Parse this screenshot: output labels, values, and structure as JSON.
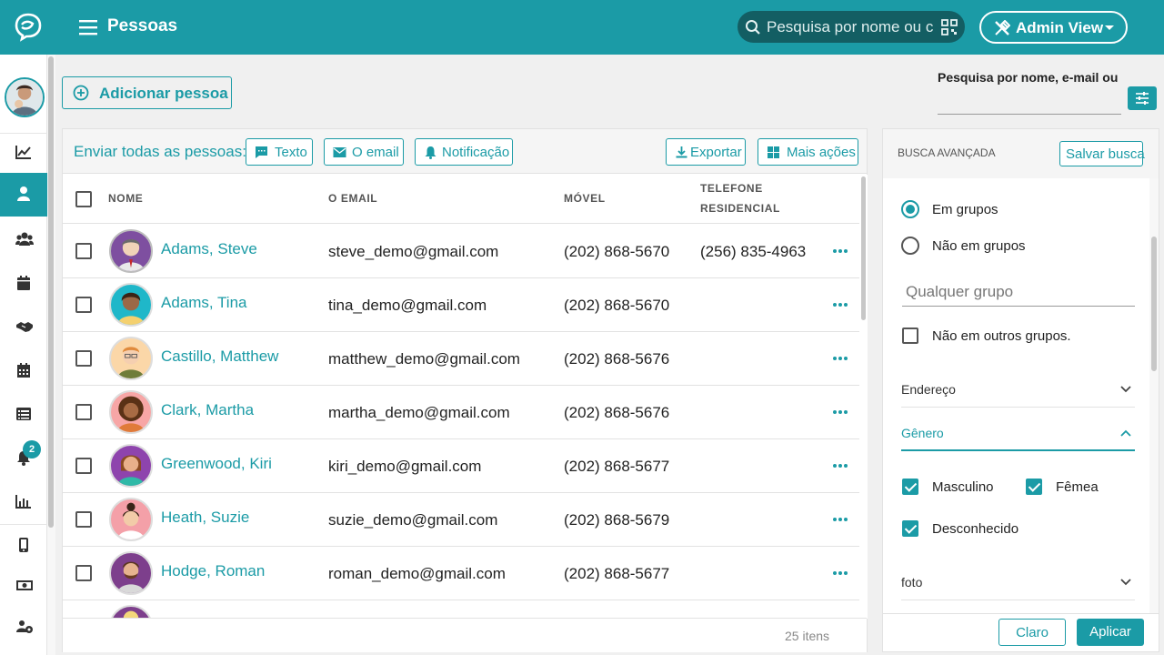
{
  "header": {
    "title": "Pessoas",
    "search_placeholder": "Pesquisa por nome ou c",
    "admin_label": "Admin View"
  },
  "sidebar": {
    "notification_count": "2",
    "items": [
      {
        "icon": "chart-line-icon"
      },
      {
        "icon": "person-icon",
        "active": true
      },
      {
        "icon": "groups-icon"
      },
      {
        "icon": "calendar-icon"
      },
      {
        "icon": "handshake-icon"
      },
      {
        "icon": "calendar-grid-icon"
      },
      {
        "icon": "list-icon"
      },
      {
        "icon": "bell-icon"
      },
      {
        "icon": "bar-chart-icon"
      },
      {
        "icon": "mobile-icon"
      },
      {
        "icon": "money-icon"
      },
      {
        "icon": "users-gear-icon"
      }
    ]
  },
  "actions": {
    "add_person": "Adicionar pessoa"
  },
  "top_search": {
    "label": "Pesquisa por nome, e-mail ou"
  },
  "toolbar": {
    "send_all": "Enviar todas as pessoas:",
    "text": "Texto",
    "email": "O email",
    "notification": "Notificação",
    "export": "Exportar",
    "more_actions": "Mais ações"
  },
  "table": {
    "headers": {
      "name": "NOME",
      "email": "O EMAIL",
      "mobile": "MÓVEL",
      "home_phone_1": "TELEFONE",
      "home_phone_2": "RESIDENCIAL"
    },
    "rows": [
      {
        "name": "Adams, Steve",
        "email": "steve_demo@gmail.com",
        "mobile": "(202) 868-5670",
        "home": "(256) 835-4963"
      },
      {
        "name": "Adams, Tina",
        "email": "tina_demo@gmail.com",
        "mobile": "(202) 868-5670",
        "home": ""
      },
      {
        "name": "Castillo, Matthew",
        "email": "matthew_demo@gmail.com",
        "mobile": "(202) 868-5676",
        "home": ""
      },
      {
        "name": "Clark, Martha",
        "email": "martha_demo@gmail.com",
        "mobile": "(202) 868-5676",
        "home": ""
      },
      {
        "name": "Greenwood, Kiri",
        "email": "kiri_demo@gmail.com",
        "mobile": "(202) 868-5677",
        "home": ""
      },
      {
        "name": "Heath, Suzie",
        "email": "suzie_demo@gmail.com",
        "mobile": "(202) 868-5679",
        "home": ""
      },
      {
        "name": "Hodge, Roman",
        "email": "roman_demo@gmail.com",
        "mobile": "(202) 868-5677",
        "home": ""
      }
    ],
    "count": "25 itens"
  },
  "advanced": {
    "title": "BUSCA AVANÇADA",
    "save_search": "Salvar busca",
    "in_groups": "Em grupos",
    "not_in_groups": "Não em grupos",
    "group_placeholder": "Qualquer grupo",
    "not_other_groups": "Não em outros grupos.",
    "address": "Endereço",
    "gender": "Gênero",
    "male": "Masculino",
    "female": "Fêmea",
    "unknown": "Desconhecido",
    "photo": "foto",
    "clear": "Claro",
    "apply": "Aplicar"
  },
  "colors": {
    "accent": "#1b9ba6",
    "search_bg": "#135e63"
  }
}
